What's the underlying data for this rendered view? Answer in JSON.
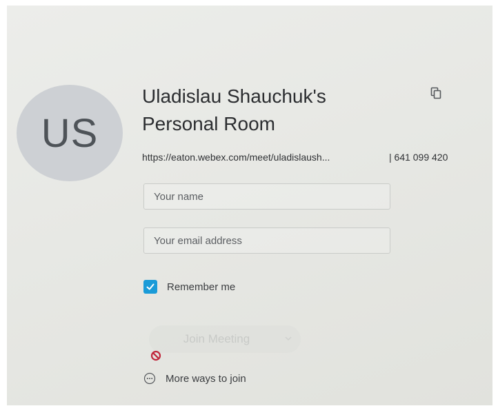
{
  "avatar": {
    "initials": "US"
  },
  "room": {
    "title": "Uladislau Shauchuk's Personal Room",
    "url": "https://eaton.webex.com/meet/uladislaush...",
    "meeting_number": "| 641 099 420"
  },
  "form": {
    "name_placeholder": "Your name",
    "email_placeholder": "Your email address",
    "remember_label": "Remember me",
    "remember_checked": true
  },
  "join": {
    "label": "Join Meeting"
  },
  "more_ways": {
    "label": "More ways to join"
  },
  "icons": {
    "copy": "copy-icon",
    "checkmark": "checkmark-icon",
    "chevron": "chevron-down-icon",
    "not_allowed": "not-allowed-icon",
    "more": "more-options-icon"
  },
  "colors": {
    "accent": "#1a9bd8",
    "avatar_bg": "#cdd0d4",
    "warning": "#c0263a"
  }
}
